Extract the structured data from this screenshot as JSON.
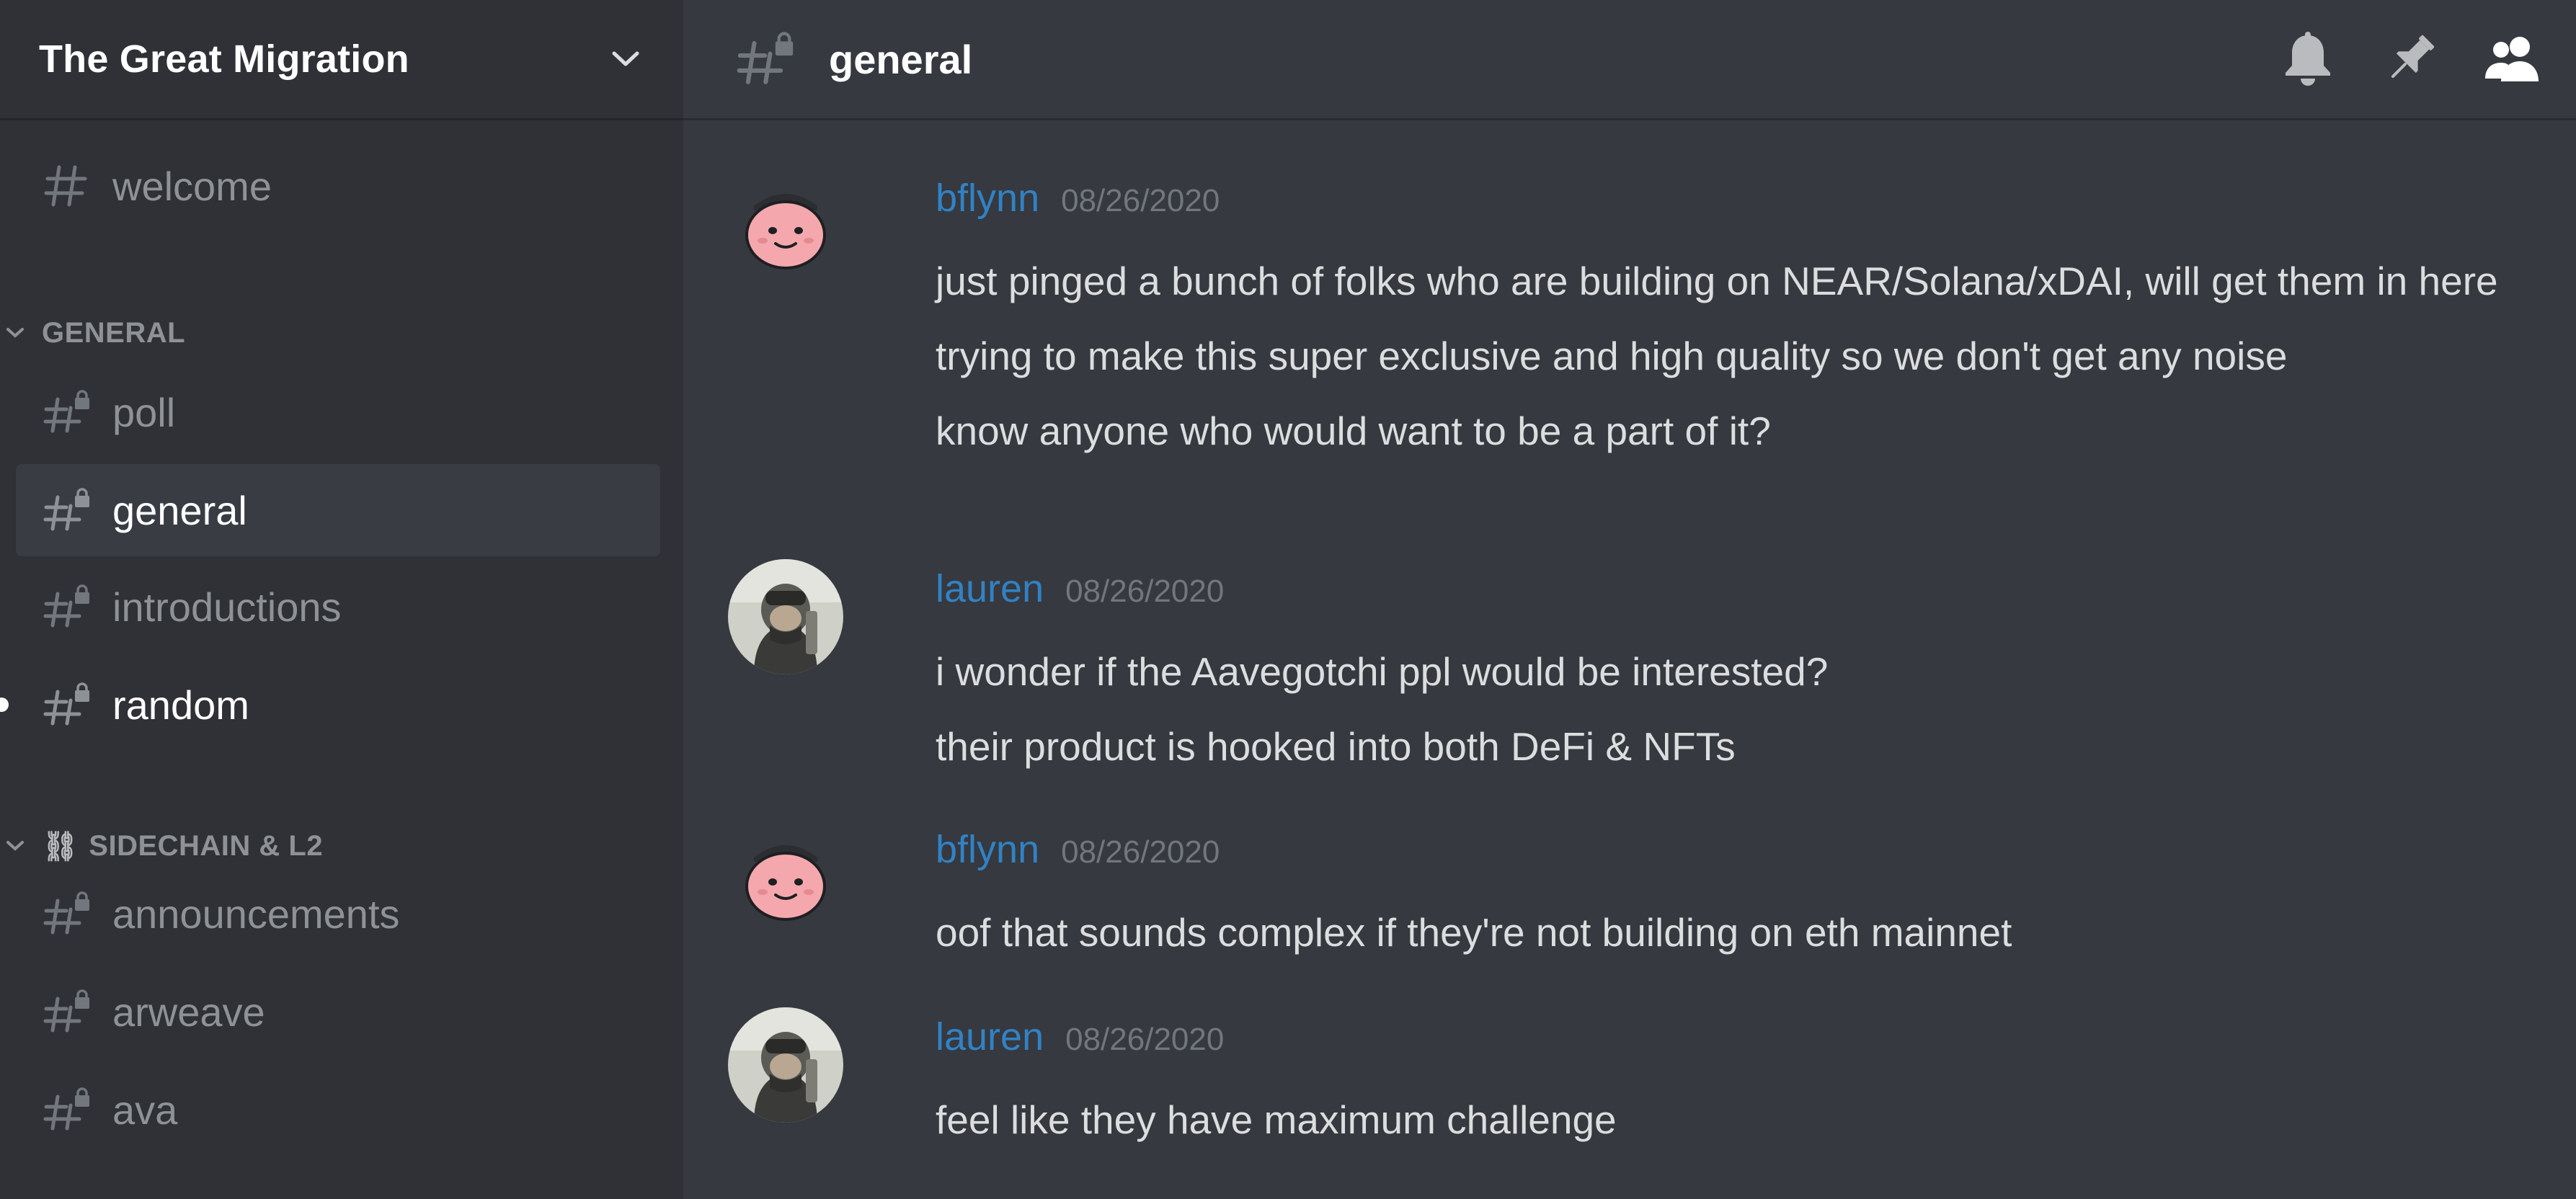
{
  "server": {
    "name": "The Great Migration",
    "menu_icon": "chevron-down-icon"
  },
  "sidebar": {
    "channels_top": [
      {
        "label": "welcome",
        "icon": "hash-icon",
        "locked": false
      }
    ],
    "categories": [
      {
        "label": "GENERAL",
        "channels": [
          {
            "label": "poll",
            "icon": "hash-lock-icon",
            "locked": true,
            "selected": false,
            "unread": false
          },
          {
            "label": "general",
            "icon": "hash-lock-icon",
            "locked": true,
            "selected": true,
            "unread": false
          },
          {
            "label": "introductions",
            "icon": "hash-lock-icon",
            "locked": true,
            "selected": false,
            "unread": false
          },
          {
            "label": "random",
            "icon": "hash-lock-icon",
            "locked": true,
            "selected": false,
            "unread": true
          }
        ]
      },
      {
        "label": "SIDECHAIN & L2",
        "emoji": "⛓",
        "channels": [
          {
            "label": "announcements",
            "icon": "hash-lock-icon",
            "locked": true
          },
          {
            "label": "arweave",
            "icon": "hash-lock-icon",
            "locked": true
          },
          {
            "label": "ava",
            "icon": "hash-lock-icon",
            "locked": true
          }
        ]
      }
    ]
  },
  "header": {
    "channel": "general",
    "icons": [
      "bell-icon",
      "pin-icon",
      "members-icon"
    ]
  },
  "messages": [
    {
      "author": "bflynn",
      "timestamp": "08/26/2020",
      "avatar": "pink-face-avatar",
      "lines": [
        "just pinged a bunch of folks who are building on NEAR/Solana/xDAI, will get them in here",
        "trying to make this super exclusive and high quality so we don't get any noise",
        "know anyone who would want to be a part of it?"
      ]
    },
    {
      "author": "lauren",
      "timestamp": "08/26/2020",
      "avatar": "photo-avatar",
      "lines": [
        "i wonder if the Aavegotchi ppl would be interested?",
        "their product is hooked into both DeFi & NFTs"
      ]
    },
    {
      "author": "bflynn",
      "timestamp": "08/26/2020",
      "avatar": "pink-face-avatar",
      "lines": [
        "oof that sounds complex if they're not building on eth mainnet"
      ]
    },
    {
      "author": "lauren",
      "timestamp": "08/26/2020",
      "avatar": "photo-avatar",
      "lines": [
        "feel like they have maximum challenge"
      ]
    }
  ],
  "colors": {
    "sidebar_bg": "#2f3136",
    "main_bg": "#36393f",
    "username": "#3182c4",
    "muted": "#8e9297",
    "text": "#dcddde",
    "selected_bg": "#393c43"
  }
}
